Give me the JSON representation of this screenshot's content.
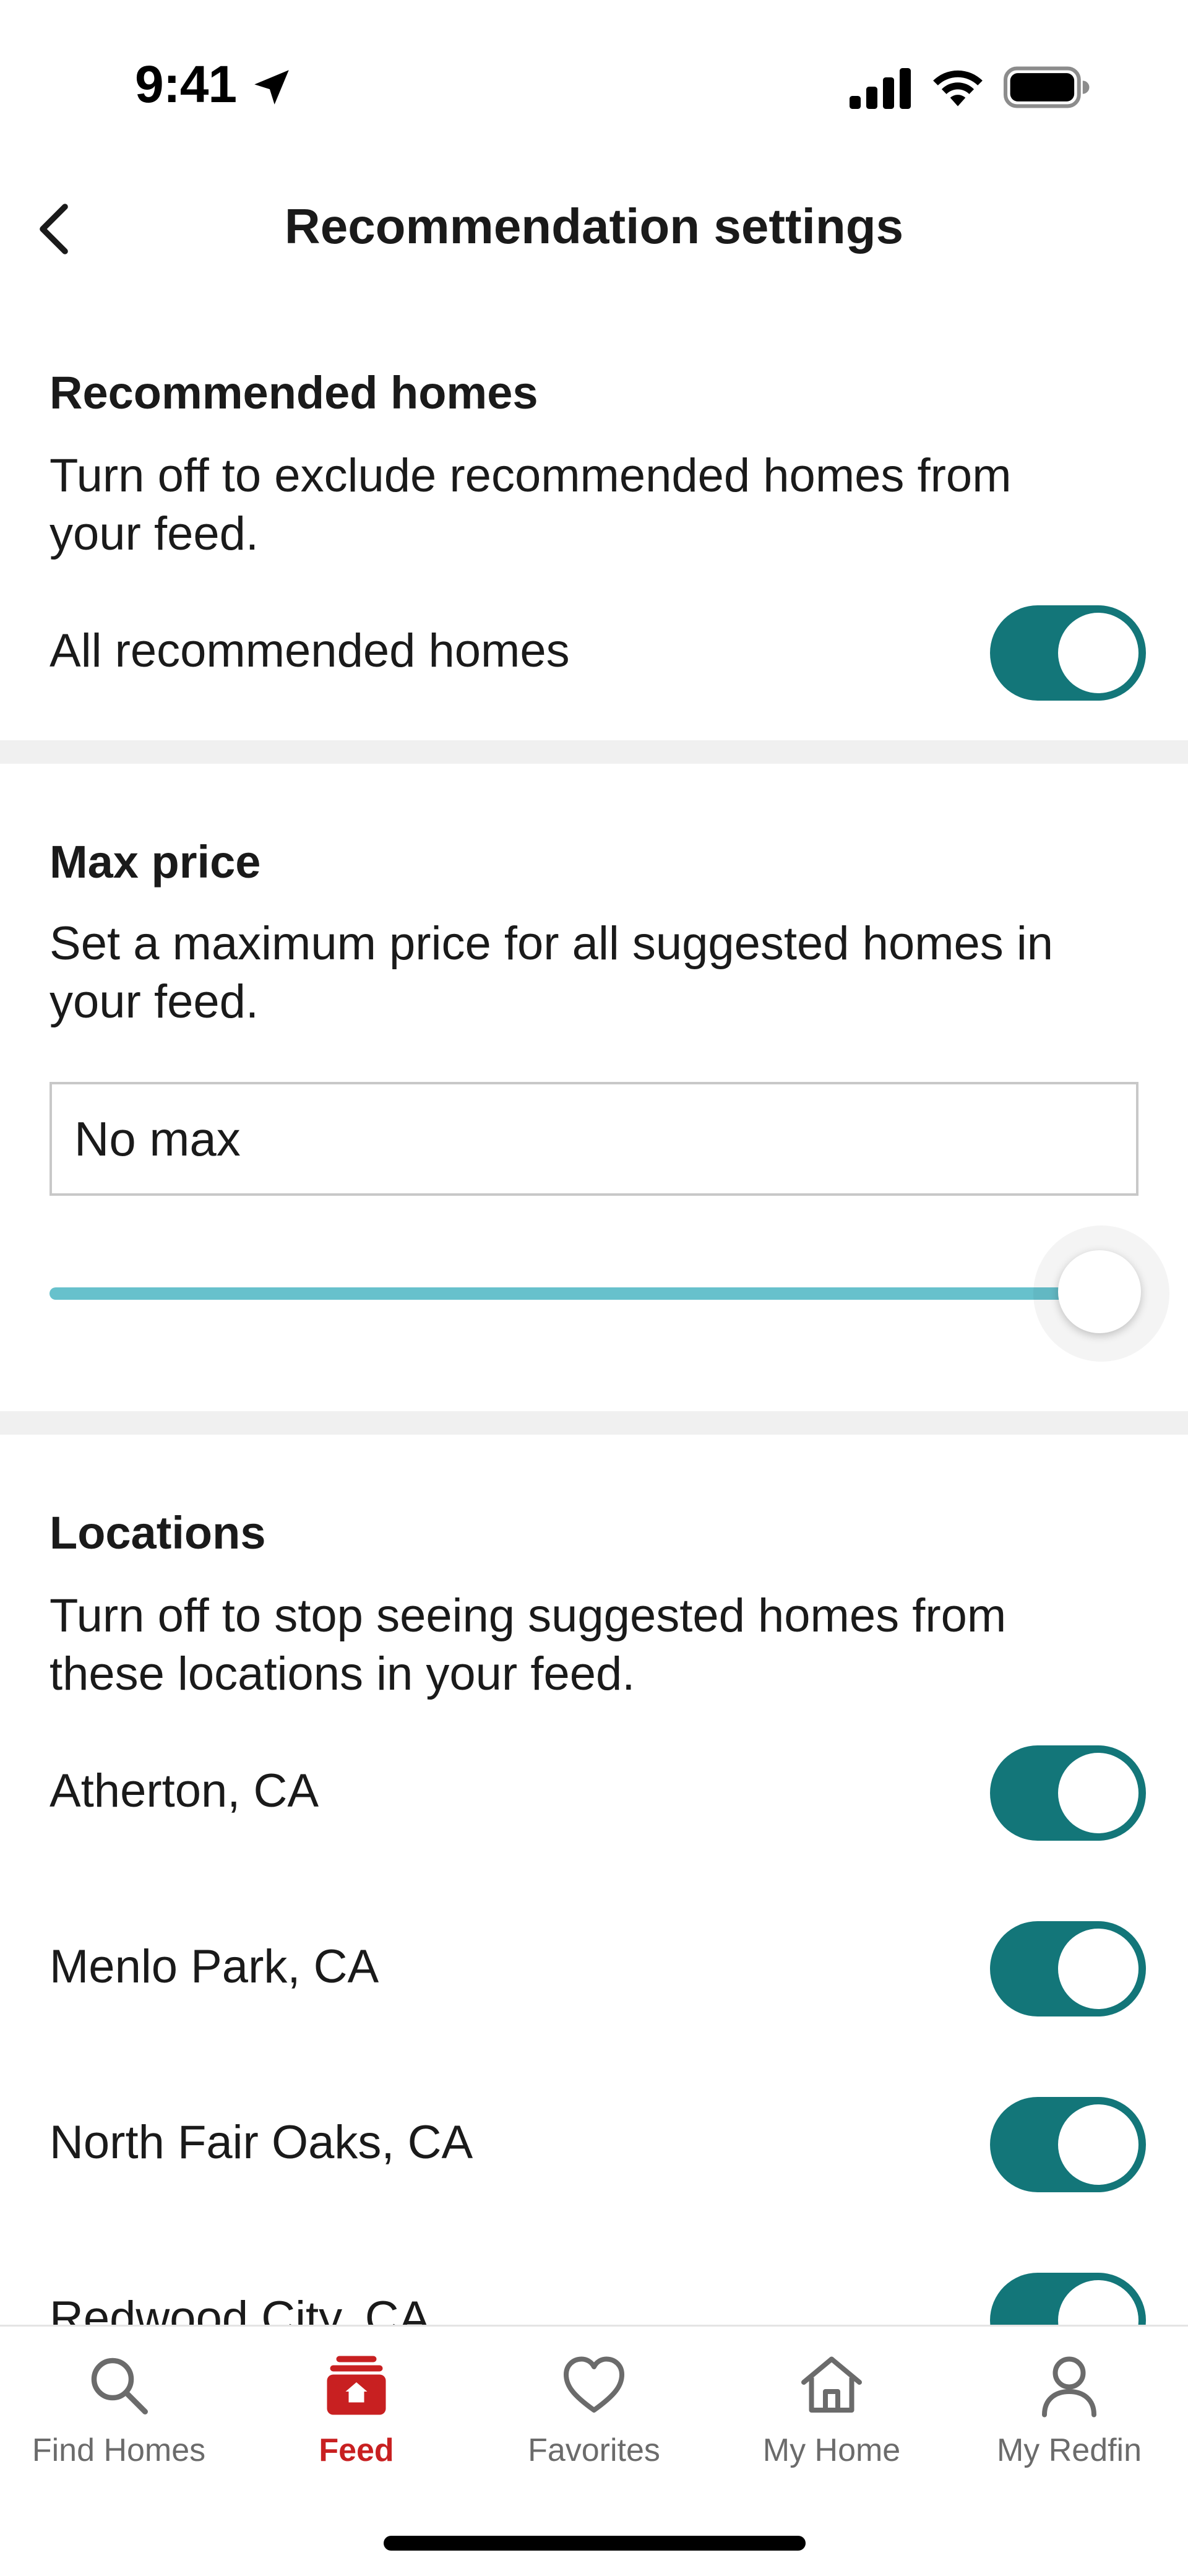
{
  "status_bar": {
    "time": "9:41",
    "icons": [
      "location-arrow-icon",
      "cellular-signal-icon",
      "wifi-icon",
      "battery-icon"
    ]
  },
  "nav": {
    "title": "Recommendation settings",
    "back_icon": "chevron-left-icon"
  },
  "recommended": {
    "heading": "Recommended homes",
    "description": "Turn off to exclude recommended homes from your feed.",
    "row_label": "All recommended homes",
    "enabled": true
  },
  "max_price": {
    "heading": "Max price",
    "description": "Set a maximum price for all suggested homes in your feed.",
    "input_value": "No max",
    "slider_level": 1.0
  },
  "locations": {
    "heading": "Locations",
    "description": "Turn off to stop seeing suggested homes from these locations in your feed.",
    "items": [
      {
        "label": "Atherton, CA",
        "enabled": true
      },
      {
        "label": "Menlo Park, CA",
        "enabled": true
      },
      {
        "label": "North Fair Oaks, CA",
        "enabled": true
      },
      {
        "label": "Redwood City, CA",
        "enabled": true
      }
    ]
  },
  "tabs": [
    {
      "label": "Find Homes",
      "icon": "search-icon",
      "active": false
    },
    {
      "label": "Feed",
      "icon": "feed-icon",
      "active": true
    },
    {
      "label": "Favorites",
      "icon": "heart-icon",
      "active": false
    },
    {
      "label": "My Home",
      "icon": "house-icon",
      "active": false
    },
    {
      "label": "My Redfin",
      "icon": "person-icon",
      "active": false
    }
  ],
  "colors": {
    "toggle_on": "#137679",
    "slider_track": "#67c1cc",
    "active_tab": "#c82021",
    "inactive_tab": "#6b6b6b",
    "divider": "#f0f0f0"
  }
}
